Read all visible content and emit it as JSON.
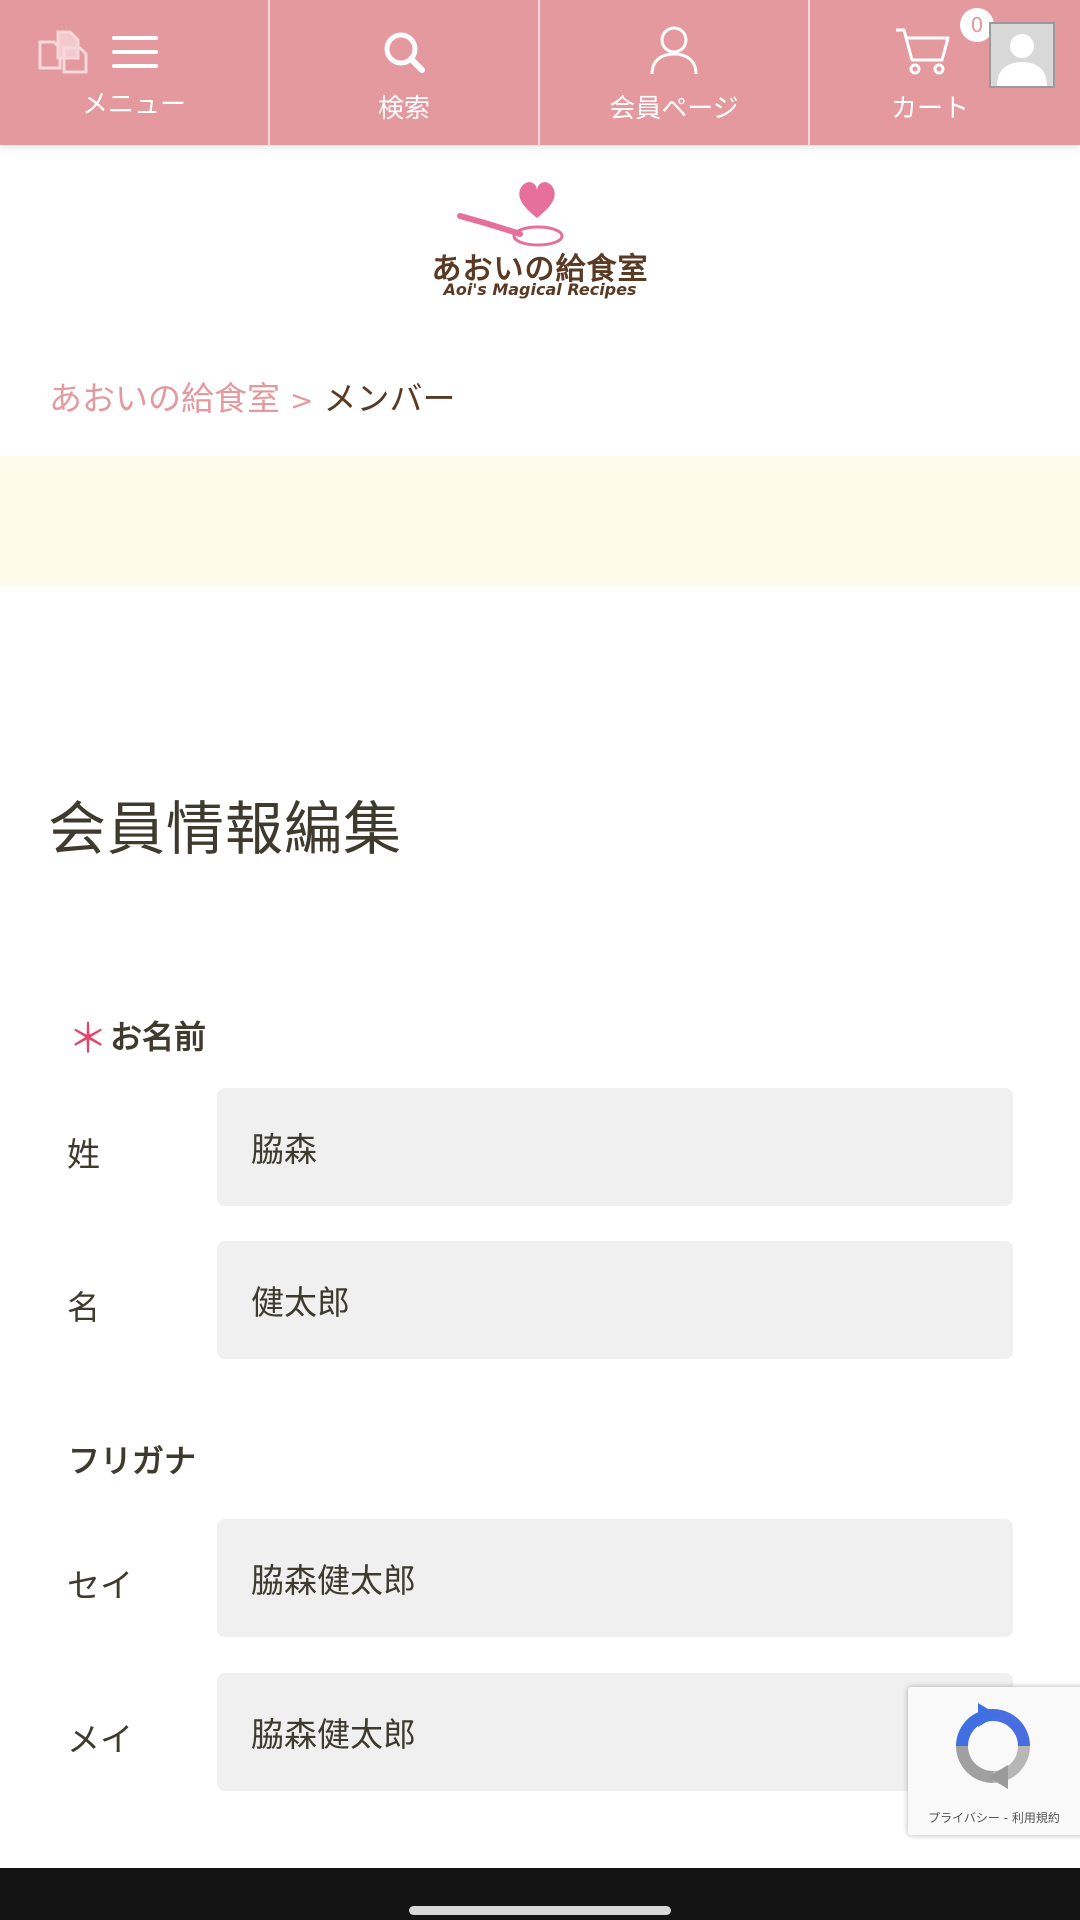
{
  "nav": {
    "menu_label": "メニュー",
    "search_label": "検索",
    "member_label": "会員ページ",
    "cart_label": "カート",
    "cart_count": "0"
  },
  "logo": {
    "name": "あおいの給食室",
    "tagline": "Aoi's Magical Recipes"
  },
  "breadcrumb": {
    "home": "あおいの給食室",
    "separator": ">",
    "current": "メンバー"
  },
  "page_title": "会員情報編集",
  "form": {
    "name_section": {
      "required_mark": "＊",
      "label": "お名前",
      "last_name_label": "姓",
      "last_name_value": "脇森",
      "first_name_label": "名",
      "first_name_value": "健太郎"
    },
    "furigana_section": {
      "label": "フリガナ",
      "sei_label": "セイ",
      "sei_value": "脇森健太郎",
      "mei_label": "メイ",
      "mei_value": "脇森健太郎"
    }
  },
  "recaptcha": {
    "text": "プライバシー - 利用規約"
  },
  "colors": {
    "nav_pink": "#e4999f",
    "banner_cream": "#fefbea",
    "required_red": "#e0476b",
    "text_brown": "#5a3a24"
  },
  "icons": {
    "pages": "pages-icon",
    "menu": "hamburger-menu-icon",
    "search": "search-icon",
    "member": "user-icon",
    "cart": "cart-icon",
    "recaptcha": "recaptcha-icon"
  }
}
